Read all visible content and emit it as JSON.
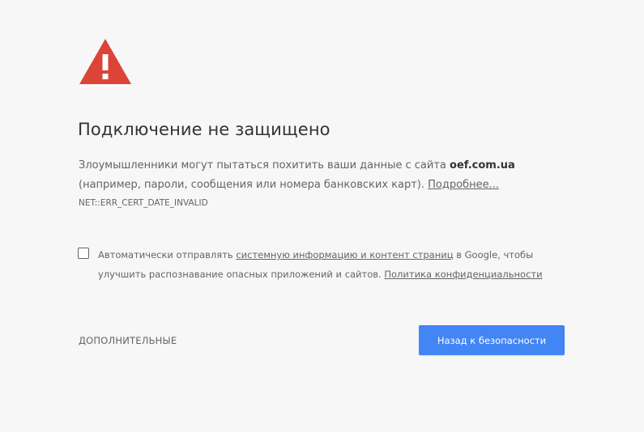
{
  "icon": {
    "name": "warning-triangle-icon",
    "color": "#db4437"
  },
  "heading": "Подключение не защищено",
  "explanation": {
    "text_before_host": "Злоумышленники могут пытаться похитить ваши данные с сайта ",
    "host": "oef.com.ua",
    "line2": "(например, пароли, сообщения или номера банковских карт). ",
    "details_link": "Подробнее..."
  },
  "error_code": "NET::ERR_CERT_DATE_INVALID",
  "optin": {
    "checked": false,
    "text_before_link": "Автоматически отправлять ",
    "link": "системную информацию и контент страниц",
    "text_after_link": " в Google, чтобы",
    "line2": "улучшить распознавание опасных приложений и сайтов. ",
    "privacy_link": "Политика конфиденциальности"
  },
  "buttons": {
    "advanced": "ДОПОЛНИТЕЛЬНЫЕ",
    "back_to_safety": "Назад к безопасности"
  },
  "colors": {
    "background": "#f7f7f7",
    "primary_button": "#4285f4",
    "warning": "#db4437"
  }
}
